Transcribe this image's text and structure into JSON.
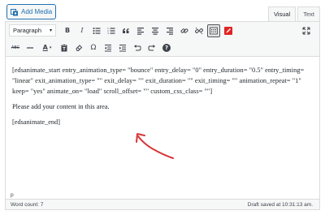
{
  "media": {
    "add_label": "Add Media",
    "icon": "media-icon"
  },
  "tabs": [
    {
      "label": "Visual",
      "active": true
    },
    {
      "label": "Text",
      "active": false
    }
  ],
  "toolbar": {
    "format_value": "Paragraph",
    "row1_icons": [
      "bold-icon",
      "italic-icon",
      "bullet-list-icon",
      "numbered-list-icon",
      "blockquote-icon",
      "align-left-icon",
      "align-center-icon",
      "align-right-icon",
      "link-icon",
      "unlink-icon",
      "toolbar-toggle-icon",
      "red-pencil-icon"
    ],
    "row2_icons": [
      "strikethrough-icon",
      "horizontal-line-icon",
      "text-color-icon",
      "paste-text-icon",
      "clear-formatting-icon",
      "special-character-icon",
      "outdent-icon",
      "indent-icon",
      "undo-icon",
      "redo-icon",
      "help-icon"
    ],
    "bold": "B",
    "italic": "I",
    "strike": "ABC",
    "text_color": "A",
    "omega": "Ω",
    "help": "?"
  },
  "content": {
    "shortcode_start": "[edsanimate_start entry_animation_type= \"bounce\" entry_delay= \"0\" entry_duration= \"0.5\" entry_timing= \"linear\" exit_animation_type= \"\" exit_delay= \"\" exit_duration= \"\" exit_timing= \"\" animation_repeat= \"1\" keep= \"yes\" animate_on= \"load\" scroll_offset= \"\" custom_css_class= \"\"]",
    "placeholder_text": "Please add your content in this area.",
    "shortcode_end": "[edsanimate_end]"
  },
  "path": "p",
  "status": {
    "word_count": "Word count: 7",
    "draft_saved": "Draft saved at 10:31:13 am."
  },
  "colors": {
    "accent": "#2271b1",
    "annotation": "#d63638",
    "pencil": "#e02424"
  }
}
